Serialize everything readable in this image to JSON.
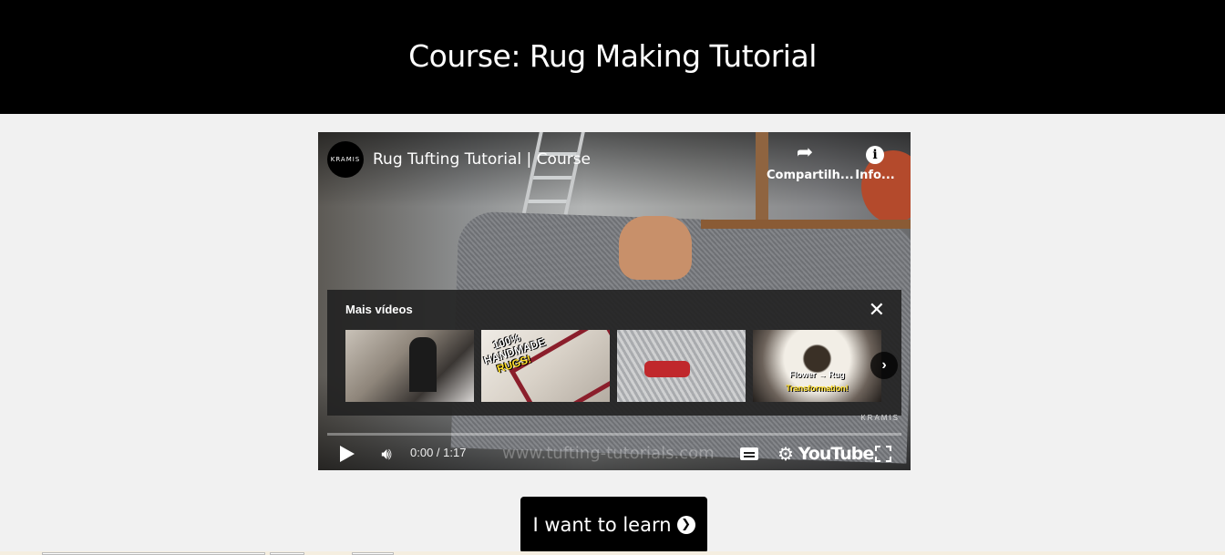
{
  "header": {
    "title": "Course: Rug Making Tutorial"
  },
  "player": {
    "channel_logo_text": "KRAMIS",
    "video_title": "Rug Tufting Tutorial | Course",
    "share_label": "Compartilh...",
    "info_label": "Info...",
    "more_videos": {
      "title": "Mais vídeos",
      "thumbs": [
        {
          "caption": ""
        },
        {
          "caption_line1": "100%",
          "caption_line2": "HANDMADE",
          "caption_line3": "RUGS!"
        },
        {
          "caption": ""
        },
        {
          "caption_line1": "Flower → Rug",
          "caption_line2": "Transformation!"
        }
      ]
    },
    "watermark_kramis": "KRAMIS",
    "site_watermark": "www.tufting-tutorials.com",
    "time": "0:00 / 1:17",
    "progress": 0,
    "youtube_label": "YouTube"
  },
  "cta": {
    "label": "I want to learn"
  },
  "icons": {
    "share": "share-arrow-icon",
    "info": "info-icon",
    "close": "close-icon",
    "next": "chevron-right-icon",
    "play": "play-icon",
    "volume": "volume-icon",
    "captions": "captions-icon",
    "settings": "gear-icon",
    "fullscreen": "fullscreen-icon",
    "cta_arrow": "arrow-circle-right-icon"
  }
}
